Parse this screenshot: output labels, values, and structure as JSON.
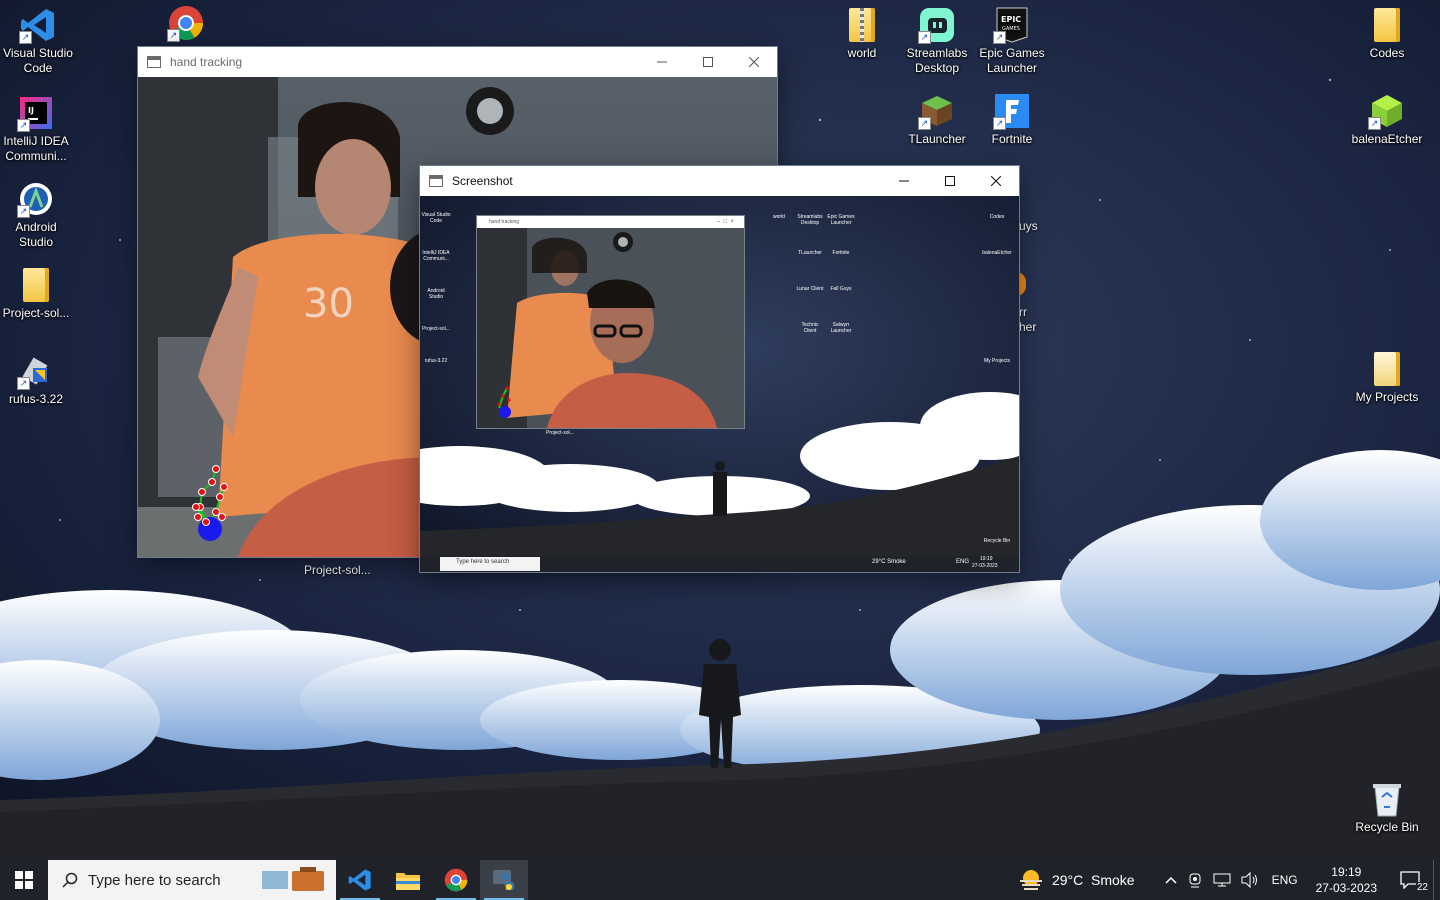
{
  "desktop": {
    "left_icons": [
      {
        "label": "Visual Studio Code",
        "icon": "vscode-icon"
      },
      {
        "label": "IntelliJ IDEA Communi...",
        "icon": "intellij-icon"
      },
      {
        "label": "Android Studio",
        "icon": "android-studio-icon"
      },
      {
        "label": "Project-sol...",
        "icon": "folder-icon"
      },
      {
        "label": "rufus-3.22",
        "icon": "rufus-icon"
      }
    ],
    "chrome_icon": "chrome-icon",
    "top_icons": [
      {
        "label": "world",
        "icon": "zip-folder-icon"
      },
      {
        "label": "Streamlabs Desktop",
        "icon": "streamlabs-icon"
      },
      {
        "label": "Epic Games Launcher",
        "icon": "epic-games-icon"
      },
      {
        "label": "TLauncher",
        "icon": "tlauncher-icon"
      },
      {
        "label": "Fortnite",
        "icon": "fortnite-icon"
      }
    ],
    "right_icons": [
      {
        "label": "Codes",
        "icon": "folder-icon"
      },
      {
        "label": "balenaEtcher",
        "icon": "balena-etcher-icon"
      },
      {
        "label": "My Projects",
        "icon": "document-folder-icon"
      },
      {
        "label": "Recycle Bin",
        "icon": "recycle-bin-icon"
      }
    ],
    "partial_labels": {
      "a": "uys",
      "b": "rr",
      "c": "her"
    },
    "under_window_label": "Project-sol..."
  },
  "windows": {
    "hand_tracking": {
      "title": "hand tracking"
    },
    "screenshot": {
      "title": "Screenshot"
    }
  },
  "nested_screenshot": {
    "mini_window_title": "hand tracking",
    "icons_left": [
      "Visual Studio Code",
      "IntelliJ IDEA Communi...",
      "Android Studio",
      "Project-sol...",
      "rufus-3.22"
    ],
    "icons_top": [
      "world",
      "Streamlabs Desktop",
      "Epic Games Launcher",
      "TLauncher",
      "Fortnite",
      "Lunar Client",
      "Fall Guys",
      "Technic Client",
      "Salwyrr Launcher"
    ],
    "icons_right": [
      "Codes",
      "balenaEtcher",
      "My Projects",
      "Recycle Bin"
    ],
    "under_label": "Project-sol...",
    "taskbar": {
      "search": "Type here to search",
      "weather": "29°C Smoke",
      "lang": "ENG",
      "time": "19:19",
      "date": "27-03-2023"
    }
  },
  "taskbar": {
    "search_placeholder": "Type here to search",
    "weather": "29°C  Smoke",
    "language": "ENG",
    "time": "19:19",
    "date": "27-03-2023",
    "notification_count": "22"
  },
  "colors": {
    "accent": "#76b9ed",
    "taskbar_bg": "#1f2228",
    "landmark_red": "#e81010",
    "landmark_green": "#16c416",
    "landmark_blue": "#1a1aee"
  }
}
